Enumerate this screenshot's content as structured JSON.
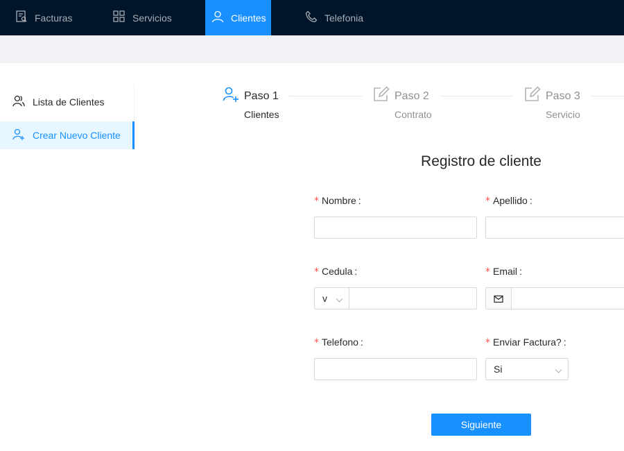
{
  "topnav": {
    "items": [
      {
        "label": "Facturas",
        "icon": "invoice-icon"
      },
      {
        "label": "Servicios",
        "icon": "grid-icon"
      },
      {
        "label": "Clientes",
        "icon": "user-icon",
        "active": true
      },
      {
        "label": "Telefonia",
        "icon": "phone-icon"
      }
    ]
  },
  "sidebar": {
    "items": [
      {
        "label": "Lista de Clientes",
        "icon": "users-icon"
      },
      {
        "label": "Crear Nuevo Cliente",
        "icon": "user-add-icon",
        "active": true
      }
    ]
  },
  "steps": [
    {
      "title": "Paso 1",
      "description": "Clientes",
      "status": "process"
    },
    {
      "title": "Paso 2",
      "description": "Contrato",
      "status": "wait"
    },
    {
      "title": "Paso 3",
      "description": "Servicio",
      "status": "wait"
    }
  ],
  "form": {
    "title": "Registro de cliente",
    "fields": {
      "nombre": {
        "label": "Nombre",
        "value": ""
      },
      "apellido": {
        "label": "Apellido",
        "value": ""
      },
      "cedula": {
        "label": "Cedula",
        "prefix": "v",
        "value": ""
      },
      "email": {
        "label": "Email",
        "value": ""
      },
      "telefono": {
        "label": "Telefono",
        "value": ""
      },
      "enviar_factura": {
        "label": "Enviar Factura?",
        "value": "Si"
      }
    },
    "required_mark": "*",
    "colon": ":",
    "submit_label": "Siguiente"
  },
  "colors": {
    "nav_bg": "#001529",
    "primary": "#1890ff",
    "required": "#ff4d4f",
    "subbar_bg": "#f0f2f5"
  }
}
